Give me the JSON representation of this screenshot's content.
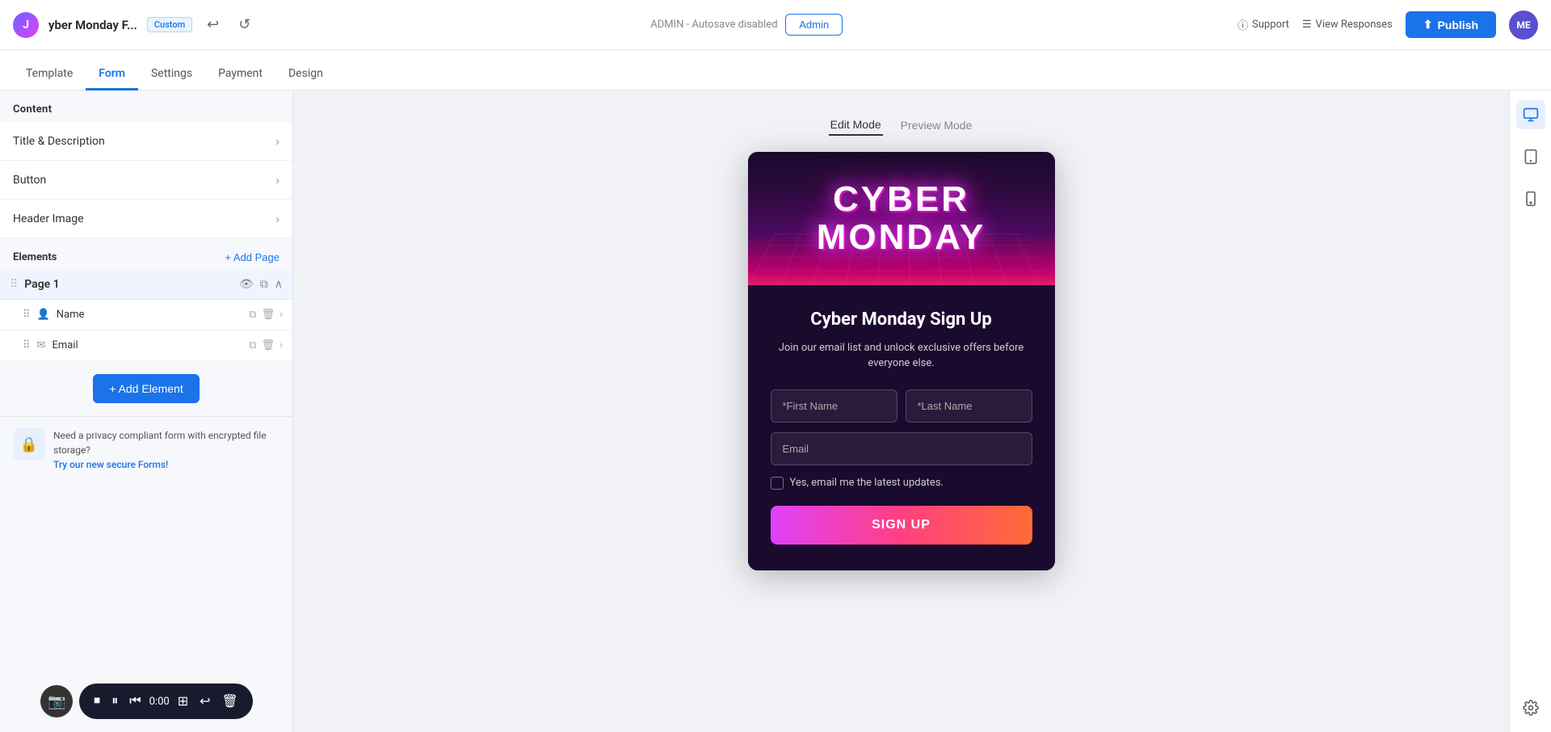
{
  "app": {
    "logo_text": "J",
    "form_title": "yber Monday F...",
    "badge_label": "Custom",
    "status_text": "ADMIN - Autosave disabled",
    "admin_btn_label": "Admin",
    "support_label": "Support",
    "view_responses_label": "View Responses",
    "publish_label": "Publish",
    "avatar_initials": "ME"
  },
  "tabs": [
    {
      "label": "Template",
      "active": false
    },
    {
      "label": "Form",
      "active": true
    },
    {
      "label": "Settings",
      "active": false
    },
    {
      "label": "Payment",
      "active": false
    },
    {
      "label": "Design",
      "active": false
    }
  ],
  "left_panel": {
    "content_header": "Content",
    "content_items": [
      {
        "label": "Title & Description"
      },
      {
        "label": "Button"
      },
      {
        "label": "Header Image"
      }
    ],
    "elements_header": "Elements",
    "add_page_label": "+ Add Page",
    "page1_name": "Page 1",
    "fields": [
      {
        "name": "Name",
        "icon": "person"
      },
      {
        "name": "Email",
        "icon": "email"
      }
    ],
    "add_element_label": "+ Add Element",
    "privacy_text": "Need a privacy compliant form with encrypted file storage?",
    "privacy_link": "Try our new secure Forms!"
  },
  "preview": {
    "edit_mode_label": "Edit Mode",
    "preview_mode_label": "Preview Mode",
    "banner_text_line1": "CYBER",
    "banner_text_line2": "MONDAY",
    "form_title": "Cyber Monday Sign Up",
    "form_subtitle": "Join our email list and unlock exclusive offers before everyone else.",
    "first_name_placeholder": "*First Name",
    "last_name_placeholder": "*Last Name",
    "email_placeholder": "Email",
    "checkbox_label": "Yes, email me the latest updates.",
    "signup_btn_label": "Sign Up"
  },
  "bottom_toolbar": {
    "time_label": "0:00"
  }
}
